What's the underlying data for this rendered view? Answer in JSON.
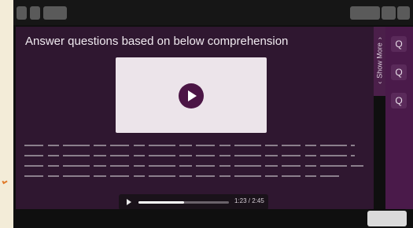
{
  "toolbar": {
    "left_buttons": [
      "menu-a",
      "menu-b",
      "menu-c"
    ],
    "right_buttons": [
      "tool-a",
      "tool-b",
      "tool-c"
    ]
  },
  "question": {
    "title": "Answer questions based on below comprehension"
  },
  "video": {
    "icon": "play-icon"
  },
  "audio": {
    "time_label": "1:23 / 2:45",
    "progress": 0.5
  },
  "side_panel": {
    "show_more_label": "Show More",
    "buttons": [
      "Q",
      "Q",
      "Q"
    ]
  },
  "colors": {
    "stage_bg": "#2f1730",
    "accent": "#4b1545",
    "rail_bg": "#4a1a4a"
  }
}
